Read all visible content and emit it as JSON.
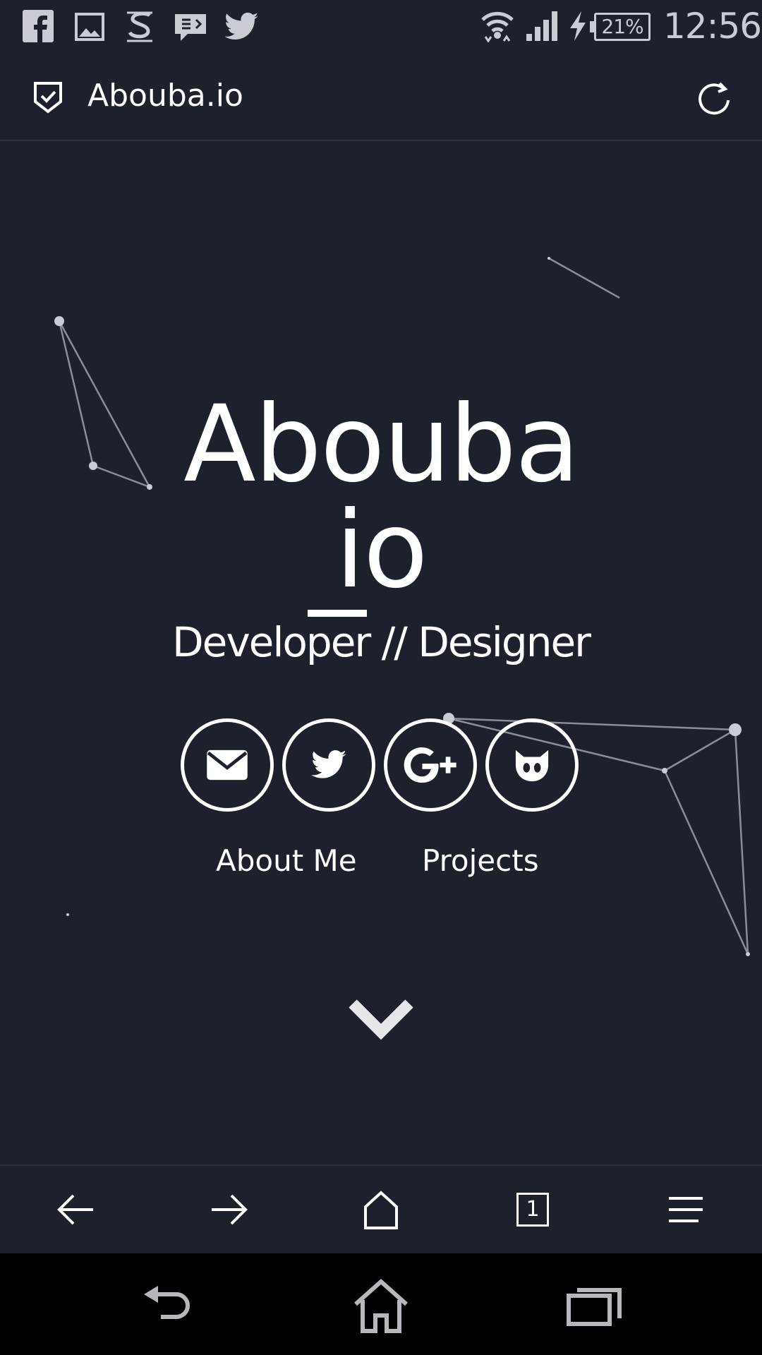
{
  "status_bar": {
    "notification_icons": [
      "facebook-icon",
      "gallery-icon",
      "s-app-icon",
      "message-icon",
      "twitter-icon"
    ],
    "battery_percent": "21%",
    "time": "12:56"
  },
  "browser": {
    "site_title": "Abouba.io"
  },
  "hero": {
    "brand_line_1": "Abouba",
    "brand_line_2": "io",
    "tagline": "Developer // Designer",
    "social_buttons": [
      "email-icon",
      "twitter-icon",
      "google-plus-icon",
      "github-icon"
    ],
    "links": {
      "about": "About Me",
      "projects": "Projects"
    }
  },
  "toolbar": {
    "tab_count": "1"
  },
  "colors": {
    "background": "#1c212c",
    "foreground": "#ffffff",
    "constellation": "#8a8e96"
  }
}
